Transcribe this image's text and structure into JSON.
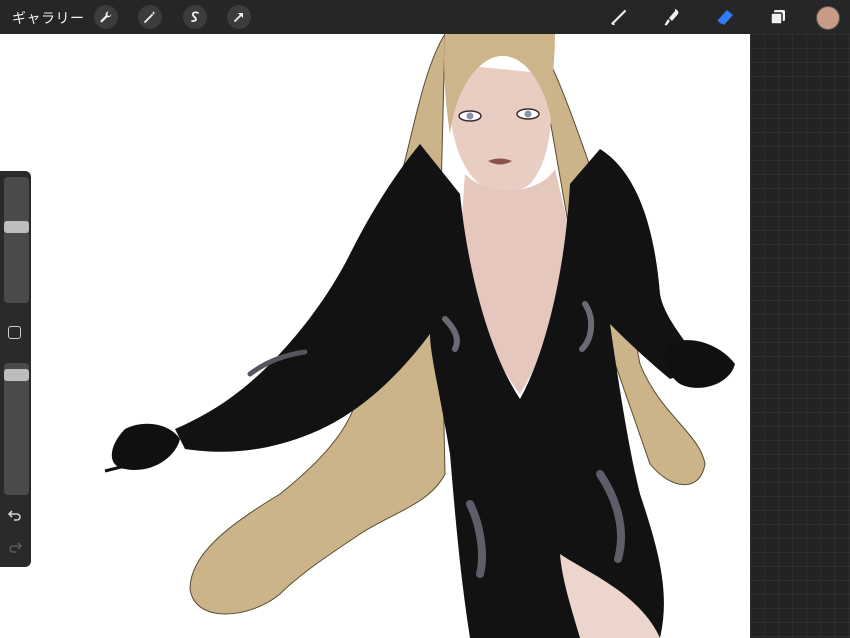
{
  "toolbar": {
    "gallery_label": "ギャラリー",
    "left_actions": [
      "wrench-icon",
      "magic-wand-icon",
      "selection-icon",
      "transform-arrow-icon"
    ],
    "right_tools": [
      "brush-icon",
      "smudge-icon",
      "eraser-icon",
      "layers-icon"
    ],
    "active_tool": "eraser-icon",
    "current_color": "#c99a85",
    "accent_color": "#2f7cf6"
  },
  "sidebar": {
    "brush_size_level": 0.3,
    "opacity_level": 0.95,
    "icons": [
      "modifier-square-icon",
      "undo-icon",
      "redo-icon"
    ]
  },
  "canvas": {
    "content": "illustration-artwork"
  }
}
